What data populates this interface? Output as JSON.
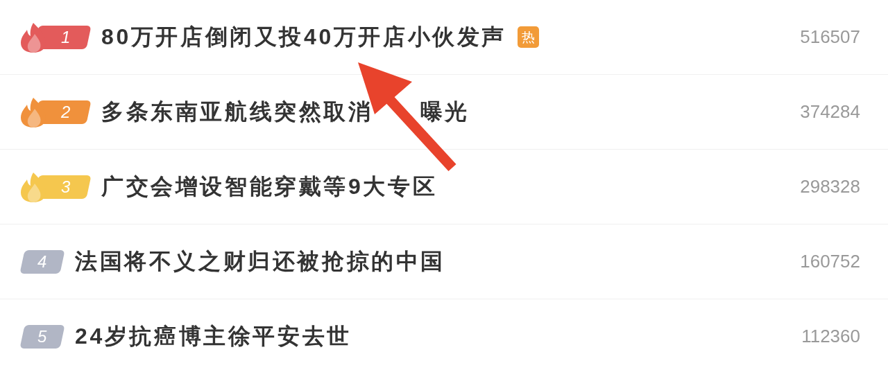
{
  "hot_list": [
    {
      "rank": "1",
      "kind": "flame",
      "color": "#e35b5b",
      "title": "80万开店倒闭又投40万开店小伙发声",
      "tag": "热",
      "count": "516507"
    },
    {
      "rank": "2",
      "kind": "flame",
      "color": "#f0913c",
      "title": "多条东南亚航线突然取消",
      "title_after_arrow": "曝光",
      "count": "374284"
    },
    {
      "rank": "3",
      "kind": "flame",
      "color": "#f5c74e",
      "title": "广交会增设智能穿戴等9大专区",
      "count": "298328"
    },
    {
      "rank": "4",
      "kind": "plain",
      "color": "#b1b6c5",
      "title": "法国将不义之财归还被抢掠的中国",
      "count": "160752"
    },
    {
      "rank": "5",
      "kind": "plain",
      "color": "#b1b6c5",
      "title": "24岁抗癌博主徐平安去世",
      "count": "112360"
    }
  ],
  "annotation": {
    "kind": "arrow"
  }
}
